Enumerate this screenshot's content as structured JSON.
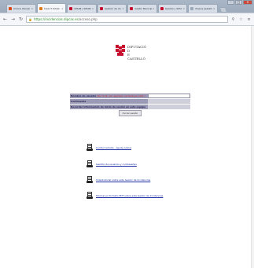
{
  "browser": {
    "tabs": [
      {
        "title": "Clinica Ibarsal de...",
        "color": "#d94a1a",
        "active": false
      },
      {
        "title": "Área IT Sihab",
        "color": "#e07a1a",
        "active": true
      },
      {
        "title": "SIHAB | SIHAB - L...",
        "color": "#c8102e",
        "active": false
      },
      {
        "title": "Gestion de client...",
        "color": "#c8102e",
        "active": false
      },
      {
        "title": "Gestio Municipal...",
        "color": "#c8102e",
        "active": false
      },
      {
        "title": "Gestion | SIHAB...",
        "color": "#c8102e",
        "active": false
      },
      {
        "title": "Nueva pestaña",
        "color": "#9aa8b8",
        "active": false
      }
    ],
    "tab_close": "×",
    "window_controls": {
      "minimize": "–",
      "maximize": "□",
      "close": "×"
    },
    "nav": {
      "back": "←",
      "forward": "→",
      "reload": "↻"
    },
    "url_scheme": "https://",
    "url_host": "incidencias.dipcas.es",
    "url_path": "/acceso.php",
    "toolbar_icons": {
      "search": "⚲",
      "star": "☆",
      "menu": "≡"
    }
  },
  "logo": {
    "line1": "DIPUTACIÓ",
    "line2": "D",
    "line3": "E",
    "line4": "CASTELLÓ",
    "color": "#c8102e"
  },
  "login": {
    "username_label": "Nombre de usuario",
    "username_hint": "(Sin la @, por ejemplo: lechado.pe rez2 )",
    "password_label": "Contraseña",
    "remember_label": "Recordar información de inicio de sesión en este equipo",
    "submit_label": "Iniciar sesión"
  },
  "links": [
    {
      "label": "Control remoto - Ayuda online"
    },
    {
      "label": "Gestión de usuarios y contraseñas"
    },
    {
      "label": "Videotutorial sobre este Gestor de Incidencias"
    },
    {
      "label": "Tutorial en formato PDF sobre este Gestor de Incidencias"
    }
  ]
}
